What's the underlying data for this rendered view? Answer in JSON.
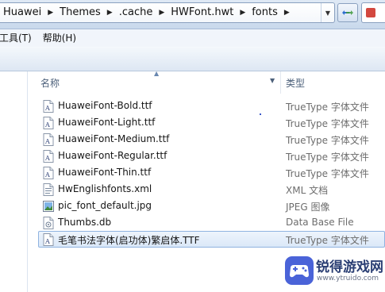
{
  "address_bar": {
    "breadcrumbs": [
      "Huawei",
      "Themes",
      ".cache",
      "HWFont.hwt",
      "fonts"
    ]
  },
  "menu": {
    "items": [
      "工具(T)",
      "帮助(H)"
    ]
  },
  "columns": {
    "name": "名称",
    "type": "类型"
  },
  "files": [
    {
      "name": "HuaweiFont-Bold.ttf",
      "type": "TrueType 字体文件",
      "icon": "font-file-icon"
    },
    {
      "name": "HuaweiFont-Light.ttf",
      "type": "TrueType 字体文件",
      "icon": "font-file-icon"
    },
    {
      "name": "HuaweiFont-Medium.ttf",
      "type": "TrueType 字体文件",
      "icon": "font-file-icon"
    },
    {
      "name": "HuaweiFont-Regular.ttf",
      "type": "TrueType 字体文件",
      "icon": "font-file-icon"
    },
    {
      "name": "HuaweiFont-Thin.ttf",
      "type": "TrueType 字体文件",
      "icon": "font-file-icon"
    },
    {
      "name": "HwEnglishfonts.xml",
      "type": "XML 文档",
      "icon": "xml-file-icon"
    },
    {
      "name": "pic_font_default.jpg",
      "type": "JPEG 图像",
      "icon": "image-file-icon"
    },
    {
      "name": "Thumbs.db",
      "type": "Data Base File",
      "icon": "db-file-icon"
    },
    {
      "name": "毛笔书法字体(启功体)繁启体.TTF",
      "type": "TrueType 字体文件",
      "icon": "font-file-icon",
      "selected": true
    }
  ],
  "watermark": {
    "brand": "锐得游戏网",
    "url": "www.ytruido.com"
  },
  "colors": {
    "selection_fill": "#dbe8f8",
    "selection_border": "#8fb3e0",
    "header_text": "#4c607a",
    "type_text": "#6d6d6d"
  }
}
